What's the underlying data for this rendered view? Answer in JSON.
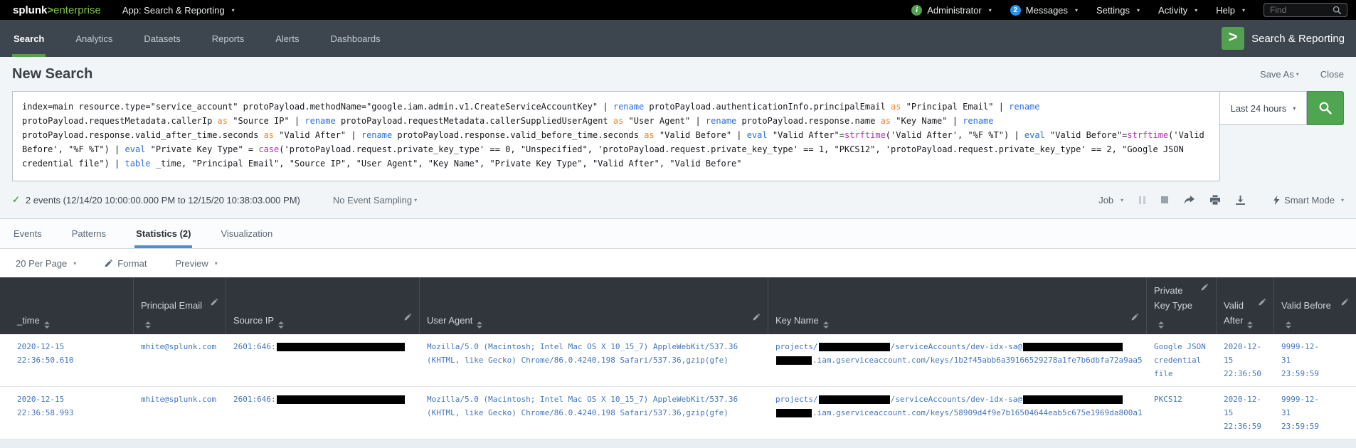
{
  "colors": {
    "splunk_green": "#53a051",
    "logo_green": "#7dc243",
    "badge_blue": "#2196f3",
    "active_tab_blue": "#4f8fcb",
    "link_blue": "#4276bd",
    "syntax_command_blue": "#2d6ce6",
    "syntax_keyword_orange": "#ea8626",
    "syntax_function_magenta": "#c12ac1",
    "table_header_bg": "#30363c"
  },
  "topbar": {
    "logo": {
      "splunk": "splunk",
      "gt": ">",
      "product": "enterprise"
    },
    "app_menu": "App: Search & Reporting",
    "user": "Administrator",
    "messages": {
      "label": "Messages",
      "badge": "2"
    },
    "settings": "Settings",
    "activity": "Activity",
    "help": "Help",
    "find_placeholder": "Find"
  },
  "appnav": {
    "items": [
      "Search",
      "Analytics",
      "Datasets",
      "Reports",
      "Alerts",
      "Dashboards"
    ],
    "app_name": "Search & Reporting"
  },
  "page": {
    "title": "New Search",
    "save_as": "Save As",
    "close": "Close"
  },
  "search": {
    "time_range": "Last 24 hours",
    "query_segments": [
      {
        "s": "p",
        "t": "index=main resource.type=\"service_account\" protoPayload.methodName=\"google.iam.admin.v1.CreateServiceAccountKey\" | "
      },
      {
        "s": "c",
        "t": "rename"
      },
      {
        "s": "p",
        "t": " protoPayload.authenticationInfo.principalEmail "
      },
      {
        "s": "k",
        "t": "as"
      },
      {
        "s": "p",
        "t": " \"Principal Email\" | "
      },
      {
        "s": "c",
        "t": "rename"
      },
      {
        "s": "p",
        "t": " protoPayload.requestMetadata.callerIp "
      },
      {
        "s": "k",
        "t": "as"
      },
      {
        "s": "p",
        "t": " \"Source IP\" | "
      },
      {
        "s": "c",
        "t": "rename"
      },
      {
        "s": "p",
        "t": " protoPayload.requestMetadata.callerSuppliedUserAgent "
      },
      {
        "s": "k",
        "t": "as"
      },
      {
        "s": "p",
        "t": " \"User Agent\" | "
      },
      {
        "s": "c",
        "t": "rename"
      },
      {
        "s": "p",
        "t": " protoPayload.response.name "
      },
      {
        "s": "k",
        "t": "as"
      },
      {
        "s": "p",
        "t": " \"Key Name\" | "
      },
      {
        "s": "c",
        "t": "rename"
      },
      {
        "s": "p",
        "t": " protoPayload.response.valid_after_time.seconds "
      },
      {
        "s": "k",
        "t": "as"
      },
      {
        "s": "p",
        "t": " \"Valid After\" | "
      },
      {
        "s": "c",
        "t": "rename"
      },
      {
        "s": "p",
        "t": " protoPayload.response.valid_before_time.seconds "
      },
      {
        "s": "k",
        "t": "as"
      },
      {
        "s": "p",
        "t": " \"Valid Before\" | "
      },
      {
        "s": "c",
        "t": "eval"
      },
      {
        "s": "p",
        "t": " \"Valid After\"="
      },
      {
        "s": "f",
        "t": "strftime"
      },
      {
        "s": "p",
        "t": "('Valid After', \"%F %T\") | "
      },
      {
        "s": "c",
        "t": "eval"
      },
      {
        "s": "p",
        "t": " \"Valid Before\"="
      },
      {
        "s": "f",
        "t": "strftime"
      },
      {
        "s": "p",
        "t": "('Valid Before', \"%F %T\") | "
      },
      {
        "s": "c",
        "t": "eval"
      },
      {
        "s": "p",
        "t": " \"Private Key Type\" = "
      },
      {
        "s": "f",
        "t": "case"
      },
      {
        "s": "p",
        "t": "('protoPayload.request.private_key_type' == 0, \"Unspecified\", 'protoPayload.request.private_key_type' == 1, \"PKCS12\", 'protoPayload.request.private_key_type' == 2, \"Google JSON credential file\") | "
      },
      {
        "s": "c",
        "t": "table"
      },
      {
        "s": "p",
        "t": " _time, \"Principal Email\", \"Source IP\", \"User Agent\", \"Key Name\", \"Private Key Type\", \"Valid After\", \"Valid Before\""
      }
    ]
  },
  "job": {
    "summary": "2 events (12/14/20 10:00:00.000 PM to 12/15/20 10:38:03.000 PM)",
    "sampling": "No Event Sampling",
    "job_label": "Job",
    "mode": "Smart Mode"
  },
  "tabs": [
    {
      "label": "Events"
    },
    {
      "label": "Patterns"
    },
    {
      "label": "Statistics (2)",
      "active": true
    },
    {
      "label": "Visualization"
    }
  ],
  "controls": {
    "per_page": "20 Per Page",
    "format": "Format",
    "preview": "Preview"
  },
  "table": {
    "columns": [
      {
        "label": "_time",
        "editable": false
      },
      {
        "label": "Principal Email",
        "editable": true
      },
      {
        "label": "Source IP",
        "editable": true
      },
      {
        "label": "User Agent",
        "editable": true
      },
      {
        "label": "Key Name",
        "editable": true
      },
      {
        "label": "Private Key Type",
        "editable": true
      },
      {
        "label": "Valid After",
        "editable": true
      },
      {
        "label": "Valid Before",
        "editable": true
      }
    ],
    "rows": [
      {
        "cells": [
          [
            {
              "t": "2020-12-15"
            },
            {
              "br": 1
            },
            {
              "t": "22:36:50.610"
            }
          ],
          [
            {
              "t": "mhite@splunk.com"
            }
          ],
          [
            {
              "t": "2601:646:"
            },
            {
              "r": 180
            }
          ],
          [
            {
              "t": "Mozilla/5.0 (Macintosh; Intel Mac OS X 10_15_7) AppleWebKit/537.36"
            },
            {
              "br": 1
            },
            {
              "t": "(KHTML, like Gecko) Chrome/86.0.4240.198 Safari/537.36,gzip(gfe)"
            }
          ],
          [
            {
              "t": "projects/"
            },
            {
              "r": 100
            },
            {
              "t": "/serviceAccounts/dev-idx-sa@"
            },
            {
              "r": 140
            },
            {
              "br": 1
            },
            {
              "r": 50
            },
            {
              "t": ".iam.gserviceaccount.com/keys/1b2f45abb6a39166529278a1fe7b6dbfa72a9aa5"
            }
          ],
          [
            {
              "t": "Google JSON"
            },
            {
              "br": 1
            },
            {
              "t": "credential"
            },
            {
              "br": 1
            },
            {
              "t": "file"
            }
          ],
          [
            {
              "t": "2020-12-"
            },
            {
              "br": 1
            },
            {
              "t": "15"
            },
            {
              "br": 1
            },
            {
              "t": "22:36:50"
            }
          ],
          [
            {
              "t": "9999-12-"
            },
            {
              "br": 1
            },
            {
              "t": "31"
            },
            {
              "br": 1
            },
            {
              "t": "23:59:59"
            }
          ]
        ]
      },
      {
        "cells": [
          [
            {
              "t": "2020-12-15"
            },
            {
              "br": 1
            },
            {
              "t": "22:36:58.993"
            }
          ],
          [
            {
              "t": "mhite@splunk.com"
            }
          ],
          [
            {
              "t": "2601:646:"
            },
            {
              "r": 180
            }
          ],
          [
            {
              "t": "Mozilla/5.0 (Macintosh; Intel Mac OS X 10_15_7) AppleWebKit/537.36"
            },
            {
              "br": 1
            },
            {
              "t": "(KHTML, like Gecko) Chrome/86.0.4240.198 Safari/537.36,gzip(gfe)"
            }
          ],
          [
            {
              "t": "projects/"
            },
            {
              "r": 100
            },
            {
              "t": "/serviceAccounts/dev-idx-sa@"
            },
            {
              "r": 140
            },
            {
              "br": 1
            },
            {
              "r": 50
            },
            {
              "t": ".iam.gserviceaccount.com/keys/58909d4f9e7b16504644eab5c675e1969da800a1"
            }
          ],
          [
            {
              "t": "PKCS12"
            }
          ],
          [
            {
              "t": "2020-12-"
            },
            {
              "br": 1
            },
            {
              "t": "15"
            },
            {
              "br": 1
            },
            {
              "t": "22:36:59"
            }
          ],
          [
            {
              "t": "9999-12-"
            },
            {
              "br": 1
            },
            {
              "t": "31"
            },
            {
              "br": 1
            },
            {
              "t": "23:59:59"
            }
          ]
        ]
      }
    ]
  }
}
